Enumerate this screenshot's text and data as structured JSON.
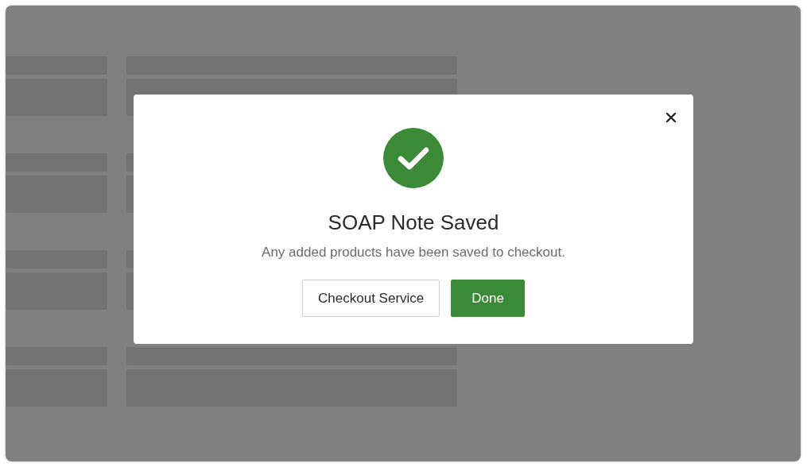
{
  "dialog": {
    "title": "SOAP Note Saved",
    "message": "Any added products have been saved to checkout.",
    "buttons": [
      {
        "label": "Checkout Service",
        "kind": "secondary"
      },
      {
        "label": "Done",
        "kind": "primary"
      }
    ]
  }
}
